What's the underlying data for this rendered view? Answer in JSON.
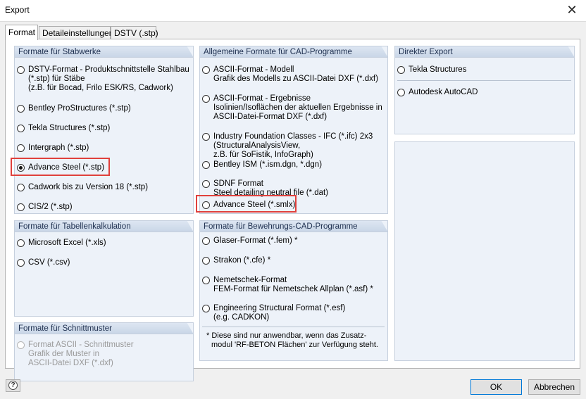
{
  "window": {
    "title": "Export",
    "close_glyph": "✕"
  },
  "tabs": [
    "Format",
    "Detaileinstellungen",
    "DSTV (.stp)"
  ],
  "groups": {
    "stabwerke": {
      "title": "Formate für Stabwerke",
      "options": [
        [
          "DSTV-Format - Produktschnittstelle Stahlbau",
          "(*.stp) für Stäbe",
          "(z.B. für Bocad, Frilo ESK/RS, Cadwork)"
        ],
        [
          "Bentley ProStructures (*.stp)"
        ],
        [
          "Tekla Structures (*.stp)"
        ],
        [
          "Intergraph (*.stp)"
        ],
        [
          "Advance Steel (*.stp)"
        ],
        [
          "Cadwork bis zu Version 18 (*.stp)"
        ],
        [
          "CIS/2 (*.stp)"
        ]
      ]
    },
    "cad": {
      "title": "Allgemeine Formate für CAD-Programme",
      "options": [
        [
          "ASCII-Format - Modell",
          "Grafik des Modells zu ASCII-Datei DXF (*.dxf)"
        ],
        [
          "ASCII-Format - Ergebnisse",
          "Isolinien/Isoflächen der aktuellen Ergebnisse in",
          "ASCII-Datei-Format DXF (*.dxf)"
        ],
        [
          "Industry Foundation Classes - IFC (*.ifc) 2x3",
          "(StructuralAnalysisView,",
          "z.B. für SoFistik, InfoGraph)"
        ],
        [
          "Bentley ISM (*.ism.dgn, *.dgn)"
        ],
        [
          "SDNF Format",
          "Steel detailing neutral file (*.dat)"
        ],
        [
          "Advance Steel (*.smlx)"
        ]
      ]
    },
    "direkt": {
      "title": "Direkter Export",
      "options": [
        [
          "Tekla Structures"
        ],
        [
          "Autodesk AutoCAD"
        ]
      ]
    },
    "tabellen": {
      "title": "Formate für Tabellenkalkulation",
      "options": [
        [
          "Microsoft Excel (*.xls)"
        ],
        [
          "CSV (*.csv)"
        ]
      ]
    },
    "bewehrung": {
      "title": "Formate für Bewehrungs-CAD-Programme",
      "options": [
        [
          "Glaser-Format  (*.fem)  *"
        ],
        [
          "Strakon (*.cfe)  *"
        ],
        [
          "Nemetschek-Format",
          "FEM-Format für Nemetschek Allplan (*.asf) *"
        ],
        [
          "Engineering Structural Format (*.esf)",
          "(e.g. CADKON)"
        ]
      ],
      "note": [
        "*  Diese sind nur anwendbar, wenn das Zusatz-",
        "modul 'RF-BETON Flächen' zur Verfügung steht."
      ]
    },
    "schnitt": {
      "title": "Formate für Schnittmuster",
      "options": [
        [
          "Format ASCII - Schnittmuster",
          "Grafik der Muster in",
          "ASCII-Datei DXF (*.dxf)"
        ]
      ]
    }
  },
  "selected": "Advance Steel (*.stp)",
  "buttons": {
    "ok": "OK",
    "cancel": "Abbrechen",
    "help": "?"
  },
  "colors": {
    "highlight": "#e0403c",
    "group_bg": "#edf2f9",
    "default_button_border": "#0078d7"
  }
}
